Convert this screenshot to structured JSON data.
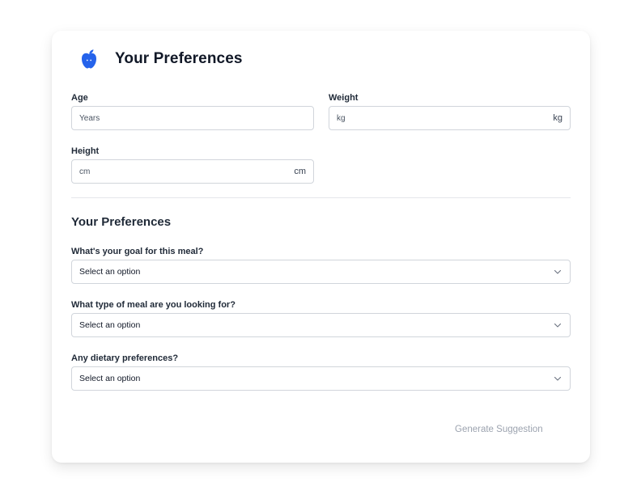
{
  "header": {
    "icon": "apple-icon",
    "title": "Your Preferences"
  },
  "fields": {
    "age": {
      "label": "Age",
      "placeholder": "Years"
    },
    "weight": {
      "label": "Weight",
      "placeholder": "kg",
      "unit": "kg"
    },
    "height": {
      "label": "Height",
      "placeholder": "cm",
      "unit": "cm"
    }
  },
  "preferences": {
    "title": "Your Preferences",
    "goal": {
      "label": "What's your goal for this meal?",
      "value": "Select an option"
    },
    "meal_type": {
      "label": "What type of meal are you looking for?",
      "value": "Select an option"
    },
    "dietary": {
      "label": "Any dietary preferences?",
      "value": "Select an option"
    }
  },
  "actions": {
    "generate_label": "Generate Suggestion"
  },
  "colors": {
    "accent": "#2563eb",
    "button_disabled": "#9ca3af",
    "border": "#d1d5db"
  }
}
